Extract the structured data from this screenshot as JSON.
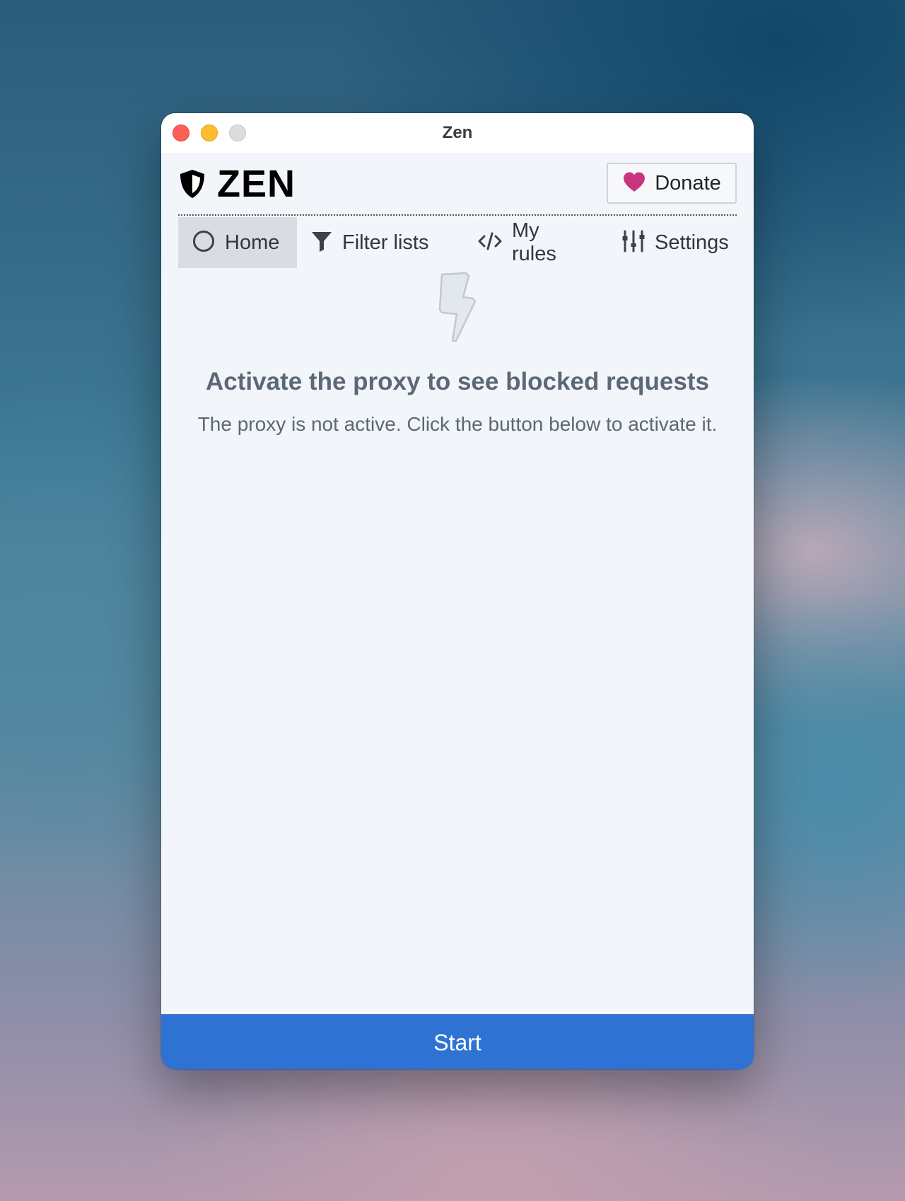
{
  "window": {
    "title": "Zen"
  },
  "header": {
    "logo_text": "ZEN",
    "logo_icon": "shield-icon",
    "donate_label": "Donate",
    "donate_icon": "heart-icon"
  },
  "nav": {
    "tabs": [
      {
        "label": "Home",
        "icon": "circle-icon",
        "active": true
      },
      {
        "label": "Filter lists",
        "icon": "filter-icon",
        "active": false
      },
      {
        "label": "My rules",
        "icon": "code-icon",
        "active": false
      },
      {
        "label": "Settings",
        "icon": "sliders-icon",
        "active": false
      }
    ]
  },
  "empty_state": {
    "icon": "lightning-bolt-icon",
    "title": "Activate the proxy to see blocked requests",
    "subtitle": "The proxy is not active. Click the button below to activate it."
  },
  "footer": {
    "start_label": "Start"
  },
  "colors": {
    "accent": "#2e73d4",
    "heart": "#c8357f",
    "active_tab": "#d9dde3",
    "window_bg": "#f2f5fa"
  }
}
